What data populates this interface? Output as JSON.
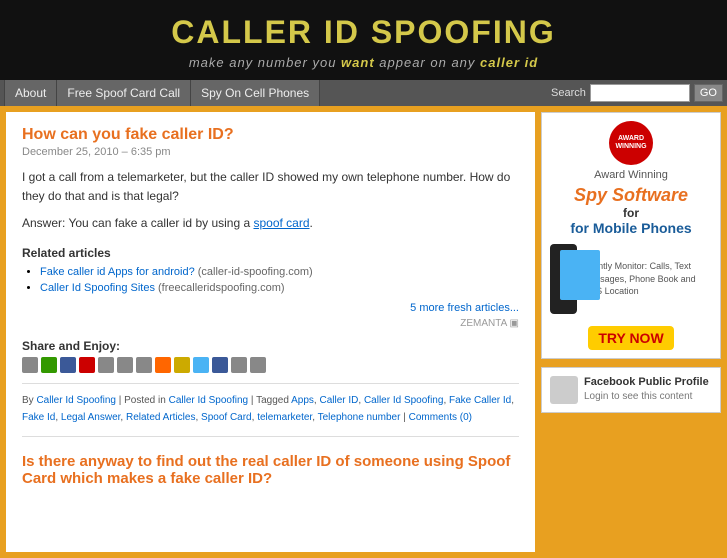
{
  "header": {
    "title": "CALLER ID SPOOFING",
    "tagline_prefix": "make any number you ",
    "tagline_highlight1": "want",
    "tagline_middle": " appear on any ",
    "tagline_highlight2": "caller id"
  },
  "nav": {
    "items": [
      {
        "label": "About",
        "id": "about"
      },
      {
        "label": "Free Spoof Card Call",
        "id": "free-spoof"
      },
      {
        "label": "Spy On Cell Phones",
        "id": "spy-phones"
      }
    ],
    "search_label": "Search",
    "search_placeholder": "",
    "go_button": "GO"
  },
  "sidebar": {
    "ad": {
      "award_text": "AWARD WINNING",
      "award_label": "Award Winning",
      "spy_software": "Spy Software",
      "for_mobile": "for Mobile Phones",
      "monitor_text": "Silently Monitor: Calls, Text Messages, Phone Book and GPS Location",
      "try_now": "TRY NOW"
    },
    "facebook": {
      "title": "Facebook Public Profile",
      "subtitle": "Login to see this content"
    }
  },
  "posts": [
    {
      "title": "How can you fake caller ID?",
      "date": "December 25, 2010 – 6:35 pm",
      "body_1": "I got a call from a telemarketer, but the caller ID showed my own telephone number. How do they do that and is that legal?",
      "body_2": "Answer: You can fake a caller id by using a",
      "body_link": "spoof card",
      "body_link_href": "#",
      "related_title": "Related articles",
      "related_items": [
        {
          "text": "Fake caller id Apps for android?",
          "href": "#",
          "meta": "(caller-id-spoofing.com)"
        },
        {
          "text": "Caller Id Spoofing Sites",
          "href": "#",
          "meta": "(freecalleridspoofing.com)"
        }
      ],
      "more_articles": "5 more fresh articles...",
      "zemanta": "ZEMANTA",
      "share_label": "Share and Enjoy:",
      "meta_by": "By",
      "meta_author": "Caller Id Spoofing",
      "meta_posted_in": "Posted in",
      "meta_category": "Caller Id Spoofing",
      "meta_tagged": "Tagged",
      "meta_tags": [
        "Apps",
        "Caller ID",
        "Caller Id Spoofing",
        "Fake Caller Id",
        "Fake Id",
        "Legal Answer",
        "Related Articles",
        "Spoof Card",
        "telemarketer",
        "Telephone number"
      ],
      "meta_comments": "Comments (0)"
    },
    {
      "title": "Is there anyway to find out the real caller ID of someone using Spoof Card which makes a fake caller ID?",
      "href": "#"
    }
  ]
}
